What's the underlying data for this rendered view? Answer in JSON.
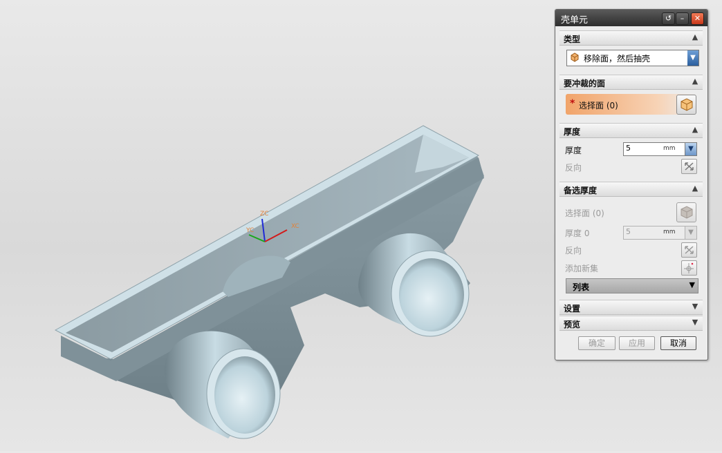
{
  "viewport": {
    "axes": {
      "zc": "ZC",
      "yc": "YC",
      "xc": "XC"
    },
    "colors": {
      "axis_z": "#1f2ad6",
      "axis_y": "#1aa81a",
      "axis_x": "#d21a1a",
      "body_light": "#aec6d1",
      "body_dark": "#6f8189",
      "rim": "#cfe0e7"
    }
  },
  "dialog": {
    "title": "壳单元",
    "title_buttons": {
      "reset_icon": "reset-icon",
      "minimize_icon": "minimize-icon",
      "close_icon": "close-icon"
    },
    "type_section": {
      "title": "类型",
      "selected": "移除面，然后抽壳",
      "icon": "shell-icon"
    },
    "faces_section": {
      "title": "要冲裁的面",
      "select_label": "选择面 (0)",
      "required_marker": "*"
    },
    "thickness_section": {
      "title": "厚度",
      "thickness_label": "厚度",
      "thickness_value": "5",
      "unit": "mm",
      "reverse_label": "反向"
    },
    "alt_thickness_section": {
      "title": "备选厚度",
      "select_label": "选择面 (0)",
      "thickness_label": "厚度 0",
      "thickness_value": "5",
      "unit": "mm",
      "reverse_label": "反向",
      "add_set_label": "添加新集",
      "list_label": "列表"
    },
    "settings_section": {
      "title": "设置"
    },
    "preview_section": {
      "title": "预览"
    },
    "footer": {
      "ok": "确定",
      "apply": "应用",
      "cancel": "取消"
    },
    "colors": {
      "select_highlight": "#f1a46a",
      "title_bar": "#2d2d2d",
      "required": "#c01010"
    }
  }
}
